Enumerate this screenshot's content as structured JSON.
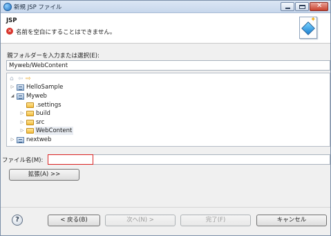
{
  "window": {
    "title": "新規 JSP ファイル"
  },
  "header": {
    "title": "JSP",
    "error_message": "名前を空白にすることはできません。"
  },
  "folder": {
    "label": "親フォルダーを入力または選択(E):",
    "value": "Myweb/WebContent"
  },
  "tree": {
    "items": [
      {
        "label": "HelloSample",
        "type": "project",
        "expanded": false
      },
      {
        "label": "Myweb",
        "type": "project",
        "expanded": true
      },
      {
        "label": ".settings",
        "type": "folder",
        "expanded": false
      },
      {
        "label": "build",
        "type": "folder",
        "expanded": false
      },
      {
        "label": "src",
        "type": "folder",
        "expanded": false
      },
      {
        "label": "WebContent",
        "type": "folder",
        "expanded": false,
        "selected": true
      },
      {
        "label": "nextweb",
        "type": "project",
        "expanded": false
      }
    ]
  },
  "filename": {
    "label": "ファイル名(M):",
    "value": ""
  },
  "buttons": {
    "extend": "拡張(A) >>",
    "back": "< 戻る(B)",
    "next": "次へ(N) >",
    "finish": "完了(F)",
    "cancel": "キャンセル",
    "help": "?"
  },
  "icons": {
    "error": "error-icon",
    "help": "help-icon",
    "project": "project-icon",
    "folder": "folder-icon"
  }
}
